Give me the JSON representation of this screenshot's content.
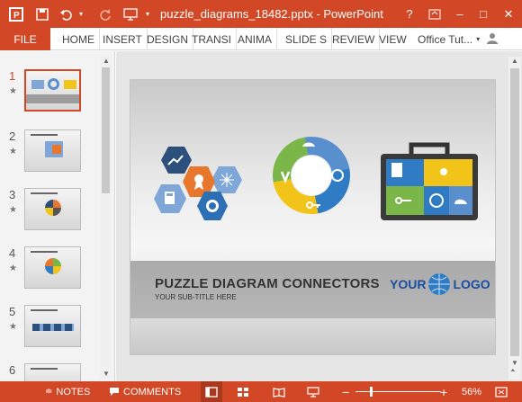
{
  "titlebar": {
    "title": "puzzle_diagrams_18482.pptx - PowerPoint",
    "help": "?",
    "minimize": "–",
    "maximize": "□",
    "close": "✕"
  },
  "ribbon": {
    "file": "FILE",
    "tabs": [
      "HOME",
      "INSERT",
      "DESIGN",
      "TRANSI",
      "ANIMA",
      "SLIDE S",
      "REVIEW",
      "VIEW"
    ],
    "account": "Office Tut..."
  },
  "thumbnails": [
    {
      "num": "1",
      "star": "★"
    },
    {
      "num": "2",
      "star": "★"
    },
    {
      "num": "3",
      "star": "★"
    },
    {
      "num": "4",
      "star": "★"
    },
    {
      "num": "5",
      "star": "★"
    },
    {
      "num": "6",
      "star": "★"
    }
  ],
  "slide": {
    "title": "PUZZLE DIAGRAM CONNECTORS",
    "subtitle": "YOUR SUB-TITLE HERE",
    "logo_left": "YOUR",
    "logo_right": "LOGO"
  },
  "statusbar": {
    "notes": "NOTES",
    "comments": "COMMENTS",
    "zoom": "56%"
  },
  "colors": {
    "accent": "#d24726",
    "puzzle_navy": "#2c4f7c",
    "puzzle_orange": "#e8772e",
    "puzzle_lightblue": "#7ea7d8",
    "puzzle_green": "#7ab648",
    "puzzle_yellow": "#f2c318",
    "puzzle_blue": "#2f7cc4"
  }
}
